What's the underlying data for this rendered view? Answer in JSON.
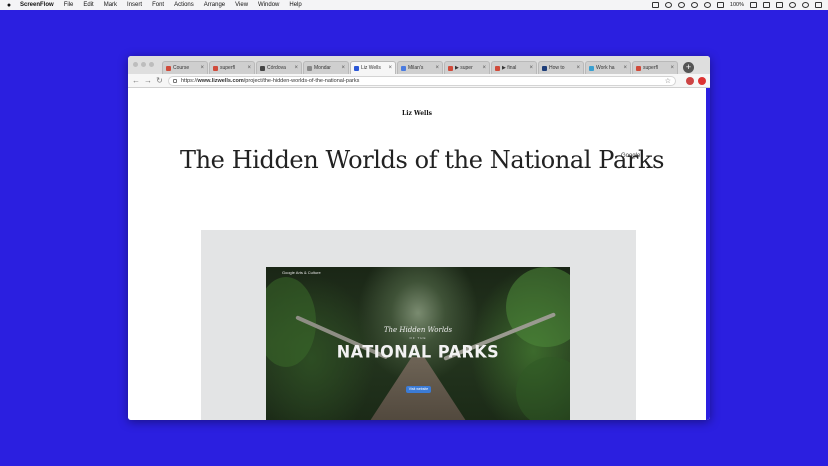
{
  "menubar": {
    "app_name": "ScreenFlow",
    "items": [
      "File",
      "Edit",
      "Mark",
      "Insert",
      "Font",
      "Actions",
      "Arrange",
      "View",
      "Window",
      "Help"
    ],
    "battery": "100%"
  },
  "browser": {
    "tabs": [
      {
        "label": "Course",
        "color": "#d04a3a"
      },
      {
        "label": "superfl",
        "color": "#d04a3a"
      },
      {
        "label": "Córdova",
        "color": "#444444"
      },
      {
        "label": "Mondar",
        "color": "#888888"
      },
      {
        "label": "Liz Wells",
        "color": "#2b57d6",
        "active": true
      },
      {
        "label": "Milan's",
        "color": "#4a7be0"
      },
      {
        "label": "▶ super",
        "color": "#d04a3a"
      },
      {
        "label": "▶ final",
        "color": "#d04a3a"
      },
      {
        "label": "How to",
        "color": "#1d3d78"
      },
      {
        "label": "Work ha",
        "color": "#3aa0d0"
      },
      {
        "label": "superfl",
        "color": "#d04a3a"
      }
    ],
    "url_prefix": "https://",
    "url_host": "www.lizwells.com",
    "url_path": "/project/the-hidden-worlds-of-the-national-parks"
  },
  "page": {
    "site_name": "Liz Wells",
    "title": "The Hidden Worlds of the National Parks",
    "google_label": "Google",
    "hero": {
      "caption": "Google Arts & Culture",
      "script_title": "The Hidden Worlds",
      "of_label": "OF THE",
      "main_title": "NATIONAL PARKS",
      "button_label": "Visit website"
    }
  }
}
